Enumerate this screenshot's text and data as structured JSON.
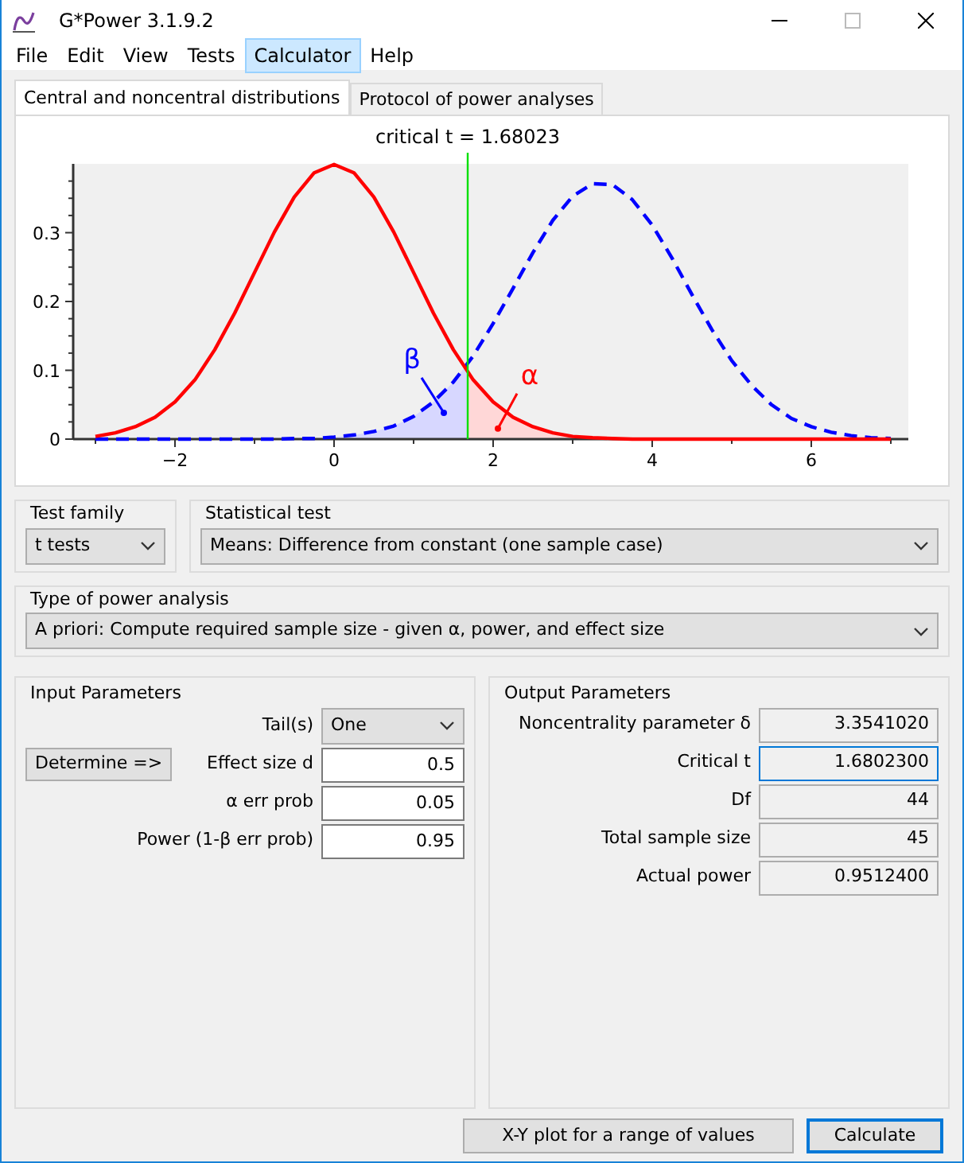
{
  "window": {
    "title": "G*Power 3.1.9.2"
  },
  "menu": [
    {
      "label": "File",
      "highlighted": false
    },
    {
      "label": "Edit",
      "highlighted": false
    },
    {
      "label": "View",
      "highlighted": false
    },
    {
      "label": "Tests",
      "highlighted": false
    },
    {
      "label": "Calculator",
      "highlighted": true
    },
    {
      "label": "Help",
      "highlighted": false
    }
  ],
  "tabs": [
    {
      "label": "Central and noncentral distributions",
      "selected": true
    },
    {
      "label": "Protocol of power analyses",
      "selected": false
    }
  ],
  "distribution_plot": {
    "chart_data": {
      "type": "line",
      "title": "critical t = 1.68023",
      "x": [
        -3,
        -2.75,
        -2.5,
        -2.25,
        -2,
        -1.75,
        -1.5,
        -1.25,
        -1,
        -0.75,
        -0.5,
        -0.25,
        0,
        0.25,
        0.5,
        0.75,
        1,
        1.25,
        1.5,
        1.75,
        2,
        2.25,
        2.5,
        2.75,
        3,
        3.25,
        3.5,
        3.75,
        4,
        4.25,
        4.5,
        4.75,
        5,
        5.25,
        5.5,
        5.75,
        6,
        6.25,
        6.5,
        6.75,
        7
      ],
      "series": [
        {
          "color": "#ff0000",
          "line_style": "solid",
          "values": [
            0.004,
            0.009,
            0.018,
            0.032,
            0.054,
            0.086,
            0.13,
            0.183,
            0.242,
            0.301,
            0.352,
            0.387,
            0.399,
            0.387,
            0.352,
            0.301,
            0.242,
            0.183,
            0.13,
            0.086,
            0.054,
            0.032,
            0.018,
            0.009,
            0.004,
            0.002,
            0.001,
            0,
            0,
            0,
            0,
            0,
            0,
            0,
            0,
            0,
            0,
            0,
            0,
            0,
            0
          ]
        },
        {
          "color": "#0000ff",
          "line_style": "dashed",
          "values": [
            0,
            0,
            0,
            0,
            0,
            0,
            0,
            0,
            0,
            0,
            0.001,
            0.001,
            0.003,
            0.006,
            0.011,
            0.019,
            0.033,
            0.054,
            0.083,
            0.121,
            0.168,
            0.219,
            0.271,
            0.318,
            0.353,
            0.371,
            0.37,
            0.348,
            0.311,
            0.263,
            0.21,
            0.159,
            0.114,
            0.078,
            0.05,
            0.03,
            0.018,
            0.01,
            0.005,
            0.002,
            0.001
          ]
        }
      ],
      "xlim": [
        -3.28,
        7.22
      ],
      "ylim": [
        0,
        0.4
      ],
      "xticks": [
        -2,
        0,
        2,
        4,
        6
      ],
      "yticks": [
        0,
        0.1,
        0.2,
        0.3
      ],
      "ref_lines": [
        {
          "axis": "x",
          "value": 1.68023,
          "color": "#00e000"
        }
      ],
      "annotations": [
        "β",
        "α"
      ]
    }
  },
  "test_family": {
    "label": "Test family",
    "value": "t tests"
  },
  "statistical_test": {
    "label": "Statistical test",
    "value": "Means: Difference from constant (one sample case)"
  },
  "power_analysis_type": {
    "label": "Type of power analysis",
    "value": "A priori: Compute required sample size - given α, power, and effect size"
  },
  "input_parameters": {
    "title": "Input Parameters",
    "fields": [
      {
        "label": "Tail(s)",
        "value": "One",
        "kind": "select"
      },
      {
        "label": "Effect size d",
        "value": "0.5",
        "kind": "input",
        "button": "Determine =>"
      },
      {
        "label": "α err prob",
        "value": "0.05",
        "kind": "input"
      },
      {
        "label": "Power (1-β err prob)",
        "value": "0.95",
        "kind": "input"
      }
    ]
  },
  "output_parameters": {
    "title": "Output Parameters",
    "fields": [
      {
        "label": "Noncentrality parameter δ",
        "value": "3.3541020",
        "focused": false
      },
      {
        "label": "Critical t",
        "value": "1.6802300",
        "focused": true
      },
      {
        "label": "Df",
        "value": "44",
        "focused": false
      },
      {
        "label": "Total sample size",
        "value": "45",
        "focused": false
      },
      {
        "label": "Actual power",
        "value": "0.9512400",
        "focused": false
      }
    ]
  },
  "buttons": [
    {
      "label": "X-Y plot for a range of values",
      "default": false
    },
    {
      "label": "Calculate",
      "default": true
    }
  ]
}
